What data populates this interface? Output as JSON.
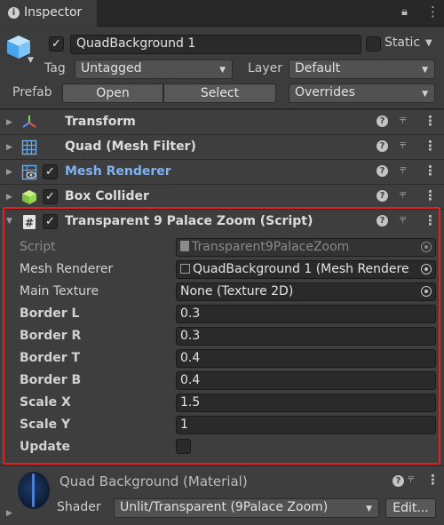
{
  "tab": {
    "label": "Inspector"
  },
  "header": {
    "name": "QuadBackground 1",
    "static_label": "Static",
    "tag_label": "Tag",
    "tag_value": "Untagged",
    "layer_label": "Layer",
    "layer_value": "Default",
    "prefab_label": "Prefab",
    "open_label": "Open",
    "select_label": "Select",
    "overrides_value": "Overrides"
  },
  "components": [
    {
      "name": "Transform",
      "icon": "transform-icon"
    },
    {
      "name": "Quad (Mesh Filter)",
      "icon": "mesh-filter-icon"
    },
    {
      "name": "Mesh Renderer",
      "icon": "mesh-renderer-icon"
    },
    {
      "name": "Box Collider",
      "icon": "box-collider-icon"
    },
    {
      "name": "Transparent 9 Palace Zoom (Script)",
      "icon": "script-icon"
    }
  ],
  "script": {
    "fields": {
      "script": {
        "label": "Script",
        "value": "Transparent9PalaceZoom"
      },
      "mesh_renderer": {
        "label": "Mesh Renderer",
        "value": "QuadBackground 1 (Mesh Rendere"
      },
      "main_texture": {
        "label": "Main Texture",
        "value": "None (Texture 2D)"
      },
      "border_l": {
        "label": "Border L",
        "value": "0.3"
      },
      "border_r": {
        "label": "Border R",
        "value": "0.3"
      },
      "border_t": {
        "label": "Border T",
        "value": "0.4"
      },
      "border_b": {
        "label": "Border B",
        "value": "0.4"
      },
      "scale_x": {
        "label": "Scale X",
        "value": "1.5"
      },
      "scale_y": {
        "label": "Scale Y",
        "value": "1"
      },
      "update": {
        "label": "Update",
        "checked": false
      }
    }
  },
  "material": {
    "name": "Quad Background (Material)",
    "shader_label": "Shader",
    "shader_value": "Unlit/Transparent (9Palace Zoom)",
    "edit_label": "Edit..."
  },
  "colors": {
    "highlight": "#e02222",
    "active_component": "#7fb2ee"
  }
}
